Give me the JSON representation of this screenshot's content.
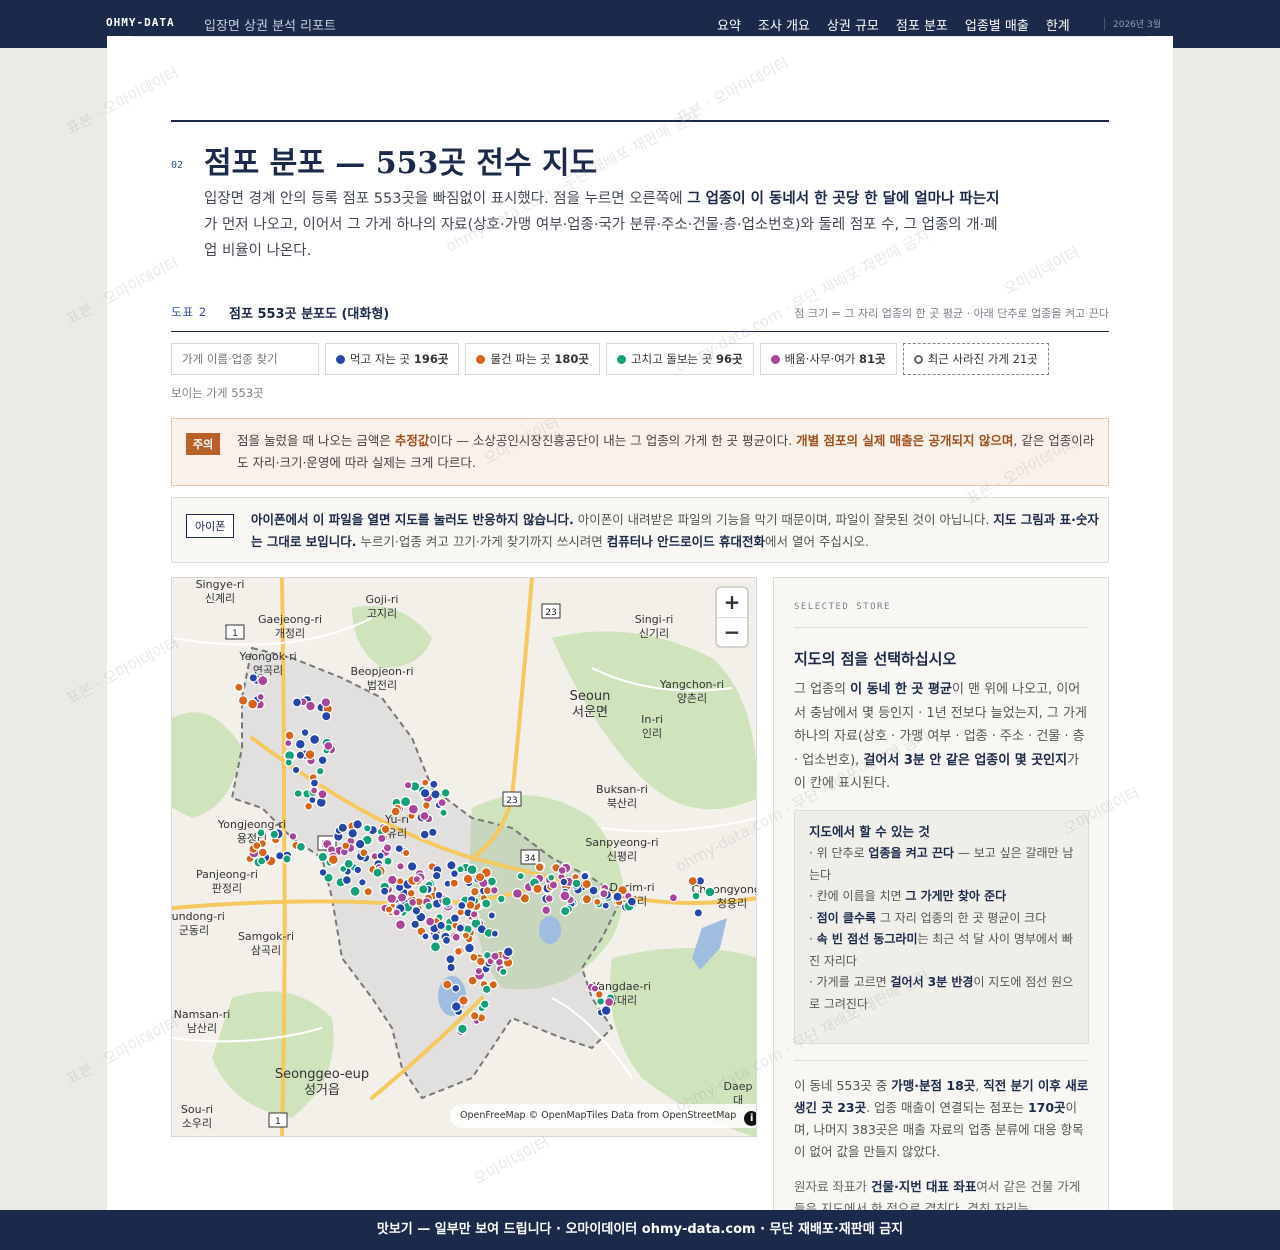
{
  "topnav": {
    "brand": "OHMY-DATA",
    "subtitle": "입장면 상권 분석 리포트",
    "links": [
      "요약",
      "조사 개요",
      "상권 규모",
      "점포 분포",
      "업종별 매출",
      "한계"
    ],
    "date": "2026년 3월"
  },
  "section": {
    "num": "02",
    "title": "점포 분포 — 553곳 전수 지도",
    "desc_1": "입장면 경계 안의 등록 점포 553곳을 빠짐없이 표시했다. 점을 누르면 오른쪽에 ",
    "desc_bold": "그 업종이 이 동네서 한 곳당 한 달에 얼마나 파는지",
    "desc_2": "가 먼저 나오고, 이어서 그 가게 하나의 자료(상호·가맹 여부·업종·국가 분류·주소·건물·층·업소번호)와 둘레 점포 수, 그 업종의 개·폐업 비율이 나온다."
  },
  "figure": {
    "label": "도표 2",
    "title": "점포 553곳 분포도 (대화형)",
    "note": "점 크기 = 그 자리 업종의 한 곳 평균 · 아래 단추로 업종을 켜고 끈다"
  },
  "controls": {
    "search_placeholder": "가게 이름·업종 찾기",
    "filters": [
      {
        "label": "먹고 자는 곳",
        "count": "196곳",
        "color": "#2647a8"
      },
      {
        "label": "물건 파는 곳",
        "count": "180곳",
        "color": "#d4651a"
      },
      {
        "label": "고치고 돌보는 곳",
        "count": "96곳",
        "color": "#15a07a"
      },
      {
        "label": "배움·사무·여가",
        "count": "81곳",
        "color": "#a8469a"
      }
    ],
    "closed": "최근 사라진 가게 21곳",
    "visible": "보이는 가게 553곳"
  },
  "warning": {
    "badge": "주의",
    "t1": "점을 눌렀을 때 나오는 금액은 ",
    "t2": "추정값",
    "t3": "이다 — 소상공인시장진흥공단이 내는 그 업종의 가게 한 곳 평균이다. ",
    "t4": "개별 점포의 실제 매출은 공개되지 않으며",
    "t5": ", 같은 업종이라도 자리·크기·운영에 따라 실제는 크게 다르다."
  },
  "ios": {
    "badge": "아이폰",
    "b1": "아이폰에서 이 파일을 열면 지도를 눌러도 반응하지 않습니다.",
    "t1": " 아이폰이 내려받은 파일의 기능을 막기 때문이며, 파일이 잘못된 것이 아닙니다. ",
    "b2": "지도 그림과 표·숫자는 그대로 보입니다.",
    "t2": " 누르기·업종 켜고 끄기·가게 찾기까지 쓰시려면 ",
    "b3": "컴퓨터나 안드로이드 휴대전화",
    "t3": "에서 열어 주십시오."
  },
  "map": {
    "zoom_in": "+",
    "zoom_out": "−",
    "attribution": "OpenFreeMap © OpenMapTiles Data from OpenStreetMap",
    "info": "i",
    "labels": [
      {
        "en": "Singye-ri",
        "ko": "신계리"
      },
      {
        "en": "Gaejeong-ri",
        "ko": "개정리"
      },
      {
        "en": "Goji-ri",
        "ko": "고지리"
      },
      {
        "en": "Singi-ri",
        "ko": "신기리"
      },
      {
        "en": "Yeongok-ri",
        "ko": "연곡리"
      },
      {
        "en": "Beopjeon-ri",
        "ko": "법전리"
      },
      {
        "en": "Seoun",
        "ko": "서운면"
      },
      {
        "en": "Yangchon-ri",
        "ko": "양촌리"
      },
      {
        "en": "In-ri",
        "ko": "인리"
      },
      {
        "en": "Buksan-ri",
        "ko": "북산리"
      },
      {
        "en": "Yongjeong-ri",
        "ko": "용정리"
      },
      {
        "en": "Yu-ri",
        "ko": "유리"
      },
      {
        "en": "Sanpyeong-ri",
        "ko": "신평리"
      },
      {
        "en": "Panjeong-ri",
        "ko": "판정리"
      },
      {
        "en": "Dorim-ri",
        "ko": "도림리"
      },
      {
        "en": "Cheongyong-ri",
        "ko": "청용리"
      },
      {
        "en": "Gundong-ri",
        "ko": "군동리"
      },
      {
        "en": "Samgok-ri",
        "ko": "삼곡리"
      },
      {
        "en": "Yangdae-ri",
        "ko": "양대리"
      },
      {
        "en": "Namsan-ri",
        "ko": "남산리"
      },
      {
        "en": "Seonggeo-eup",
        "ko": "성거읍"
      },
      {
        "en": "Sou-ri",
        "ko": "소우리"
      },
      {
        "en": "Daep",
        "ko": "대"
      }
    ],
    "roads": [
      "1",
      "23",
      "23",
      "34",
      "34",
      "1"
    ]
  },
  "panel": {
    "kicker": "SELECTED STORE",
    "title": "지도의 점을 선택하십시오",
    "p1": "그 업종의 ",
    "p1b": "이 동네 한 곳 평균",
    "p2": "이 맨 위에 나오고, 이어서 충남에서 몇 등인지 · 1년 전보다 늘었는지, 그 가게 하나의 자료(상호 · 가맹 여부 · 업종 · 주소 · 건물 · 층 · 업소번호), ",
    "p2b": "걸어서 3분 안 같은 업종이 몇 곳인지",
    "p3": "가 이 칸에 표시된다.",
    "howto_title": "지도에서 할 수 있는 것",
    "h1a": "· 위 단추로 ",
    "h1b": "업종을 켜고 끈다",
    "h1c": " — 보고 싶은 갈래만 남는다",
    "h2a": "· 칸에 이름을 치면 ",
    "h2b": "그 가게만 찾아 준다",
    "h3a": "· ",
    "h3b": "점이 클수록",
    "h3c": " 그 자리 업종의 한 곳 평균이 크다",
    "h4a": "· ",
    "h4b": "속 빈 점선 동그라미",
    "h4c": "는 최근 석 달 사이 명부에서 빠진 자리다",
    "h5a": "· 가게를 고르면 ",
    "h5b": "걸어서 3분 반경",
    "h5c": "이 지도에 점선 원으로 그려진다",
    "s1": "이 동네 553곳 중 ",
    "s1b": "가맹·분점 18곳",
    "s2": ", ",
    "s2b": "직전 분기 이후 새로 생긴 곳 23곳",
    "s3": ". 업종 매출이 연결되는 점포는 ",
    "s3b": "170곳",
    "s4": "이며, 나머지 383곳은 매출 자료의 업종 분류에 대응 항목이 없어 값을 만들지 않았다.",
    "m1": "원자료 좌표가 ",
    "m1b": "건물·지번 대표 좌표",
    "m2": "여서 같은 건물 가게들은 지도에서 한 점으로 겹친다. 겹친 자리는"
  },
  "footer": "맛보기 — 일부만 보여 드립니다 · 오마이데이터 ohmy-data.com · 무단 재배포·재판매 금지",
  "watermark": {
    "w1": "표본 · 오마이데이터",
    "w2": "ohmy-data.com · 무단 재배포·재판매 금지",
    "w3": "오마이데이터"
  }
}
